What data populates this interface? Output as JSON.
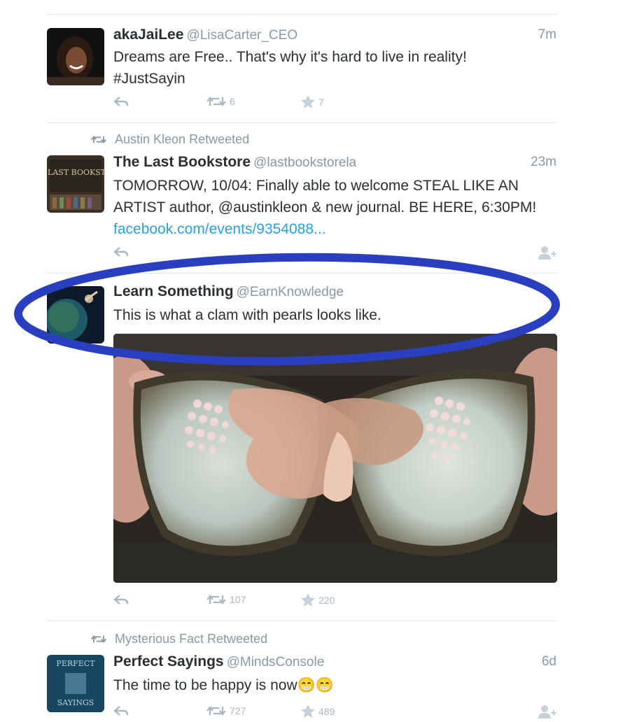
{
  "tweets": [
    {
      "name": "akaJaiLee",
      "handle": "@LisaCarter_CEO",
      "time": "7m",
      "text": "Dreams are Free.. That's why it's hard to live in reality! #JustSayin",
      "retweets": "6",
      "favorites": "7"
    },
    {
      "retweeted_by": "Austin Kleon Retweeted",
      "name": "The Last Bookstore",
      "handle": "@lastbookstorela",
      "time": "23m",
      "text": "TOMORROW, 10/04: Finally able to welcome STEAL LIKE AN ARTIST author, @austinkleon & new journal. BE HERE, 6:30PM!",
      "link": "facebook.com/events/9354088...",
      "avatar_text": "THE LAST BOOKSTORE"
    },
    {
      "name": "Learn Something",
      "handle": "@EarnKnowledge",
      "text": "This is what a clam with pearls looks like.",
      "retweets": "107",
      "favorites": "220"
    },
    {
      "retweeted_by": "Mysterious Fact Retweeted",
      "name": "Perfect Sayings",
      "handle": "@MindsConsole",
      "time": "6d",
      "text": "The time to be happy is now",
      "emoji": "😁😁",
      "retweets": "727",
      "favorites": "489",
      "avatar_text_top": "PERFECT",
      "avatar_text_bottom": "SAYINGS"
    }
  ],
  "colors": {
    "annotation": "#2a3fbf",
    "link": "#2b9fe0",
    "muted": "#8899a6"
  }
}
